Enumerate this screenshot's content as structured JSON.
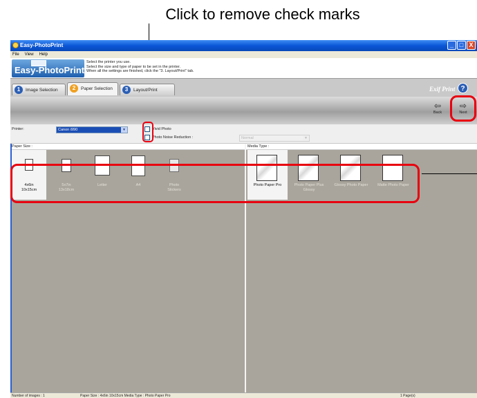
{
  "caption": "Click to remove check marks",
  "window": {
    "title": "Easy-PhotoPrint",
    "controls": [
      "_",
      "□",
      "X"
    ]
  },
  "menu": [
    "File",
    "View",
    "Help"
  ],
  "banner": {
    "logo": "Easy-PhotoPrint",
    "instructions": [
      "Select the printer you use.",
      "Select the size and type of paper to be set in the printer.",
      "When all the settings are finished, click the \"3. Layout/Print\" tab."
    ]
  },
  "tabs": [
    {
      "num": "1",
      "label": "Image Selection",
      "color": "#2b5fb5"
    },
    {
      "num": "2",
      "label": "Paper Selection",
      "color": "#f0a020"
    },
    {
      "num": "3",
      "label": "Layout/Print",
      "color": "#2b5fb5"
    }
  ],
  "brand": "Exif Print",
  "help": "?",
  "nav": {
    "back": {
      "arrow": "⇦",
      "label": "Back"
    },
    "next": {
      "arrow": "⇨",
      "label": "Next"
    }
  },
  "controls": {
    "printer_label": "Printer:",
    "printer_value": "Canon i990",
    "vivid_photo": "Vivid Photo",
    "noise_reduction": "Photo Noise Reduction :",
    "noise_value": "Normal"
  },
  "paper_size": {
    "header": "Paper Size :",
    "items": [
      {
        "label": "4x6in\n10x15cm",
        "selected": true
      },
      {
        "label": "5x7in\n13x18cm",
        "selected": false
      },
      {
        "label": "Letter",
        "selected": false
      },
      {
        "label": "A4",
        "selected": false
      },
      {
        "label": "Photo\nStickers",
        "selected": false
      }
    ]
  },
  "media_type": {
    "header": "Media Type :",
    "items": [
      {
        "label": "Photo Paper Pro",
        "selected": true
      },
      {
        "label": "Photo Paper Plus\nGlossy",
        "selected": false
      },
      {
        "label": "Glossy Photo Paper",
        "selected": false
      },
      {
        "label": "Matte Photo Paper",
        "selected": false
      }
    ]
  },
  "status": {
    "images": "Number of images : 1",
    "selection": "Paper Size : 4x6in 10x15cm  Media Type : Photo Paper Pro",
    "pages": "1 Page(s)"
  },
  "colors": {
    "highlight": "#e8000f",
    "titlebar": "#0a57d8"
  }
}
